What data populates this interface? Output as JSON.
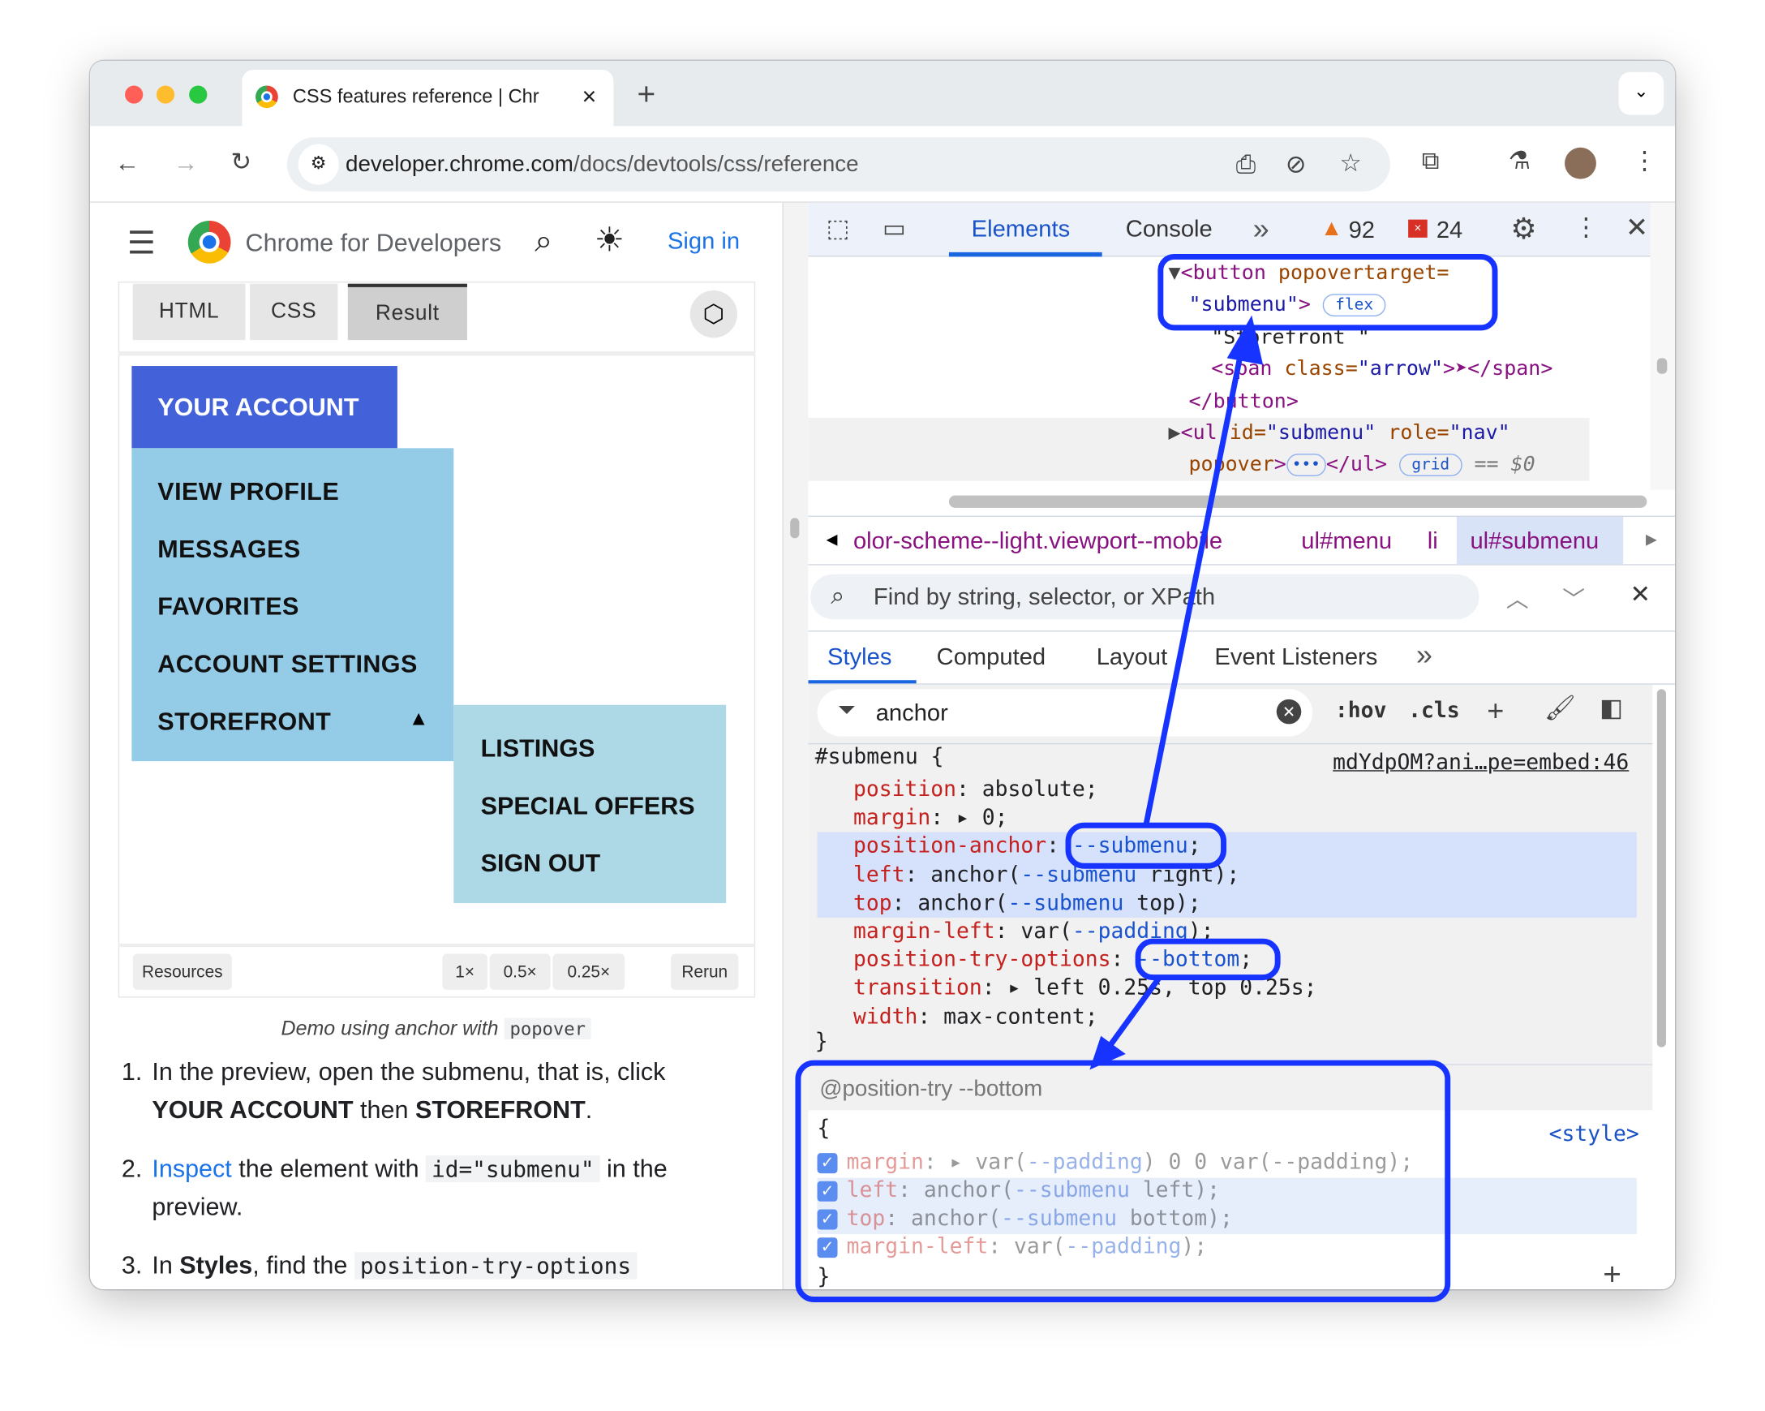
{
  "browser": {
    "tab_title": "CSS features reference | Chr",
    "url_domain": "developer.chrome.com",
    "url_path": "/docs/devtools/css/reference",
    "new_tab": "+",
    "close_tab": "×"
  },
  "site": {
    "name": "Chrome for Developers",
    "sign_in": "Sign in"
  },
  "codepen": {
    "tabs": [
      "HTML",
      "CSS",
      "Result"
    ],
    "active_tab": "Result",
    "menu_button": "YOUR ACCOUNT",
    "menu_items": [
      "VIEW PROFILE",
      "MESSAGES",
      "FAVORITES",
      "ACCOUNT SETTINGS",
      "STOREFRONT"
    ],
    "arrow": "▲",
    "submenu_items": [
      "LISTINGS",
      "SPECIAL OFFERS",
      "SIGN OUT"
    ],
    "footer": {
      "resources": "Resources",
      "zoom": [
        "1×",
        "0.5×",
        "0.25×"
      ],
      "rerun": "Rerun"
    }
  },
  "article": {
    "caption_text": "Demo using anchor with",
    "caption_code": "popover",
    "steps": [
      {
        "num": "1.",
        "a": "In the preview, open the submenu, that is, click ",
        "b1": "YOUR ACCOUNT",
        "c": " then ",
        "b2": "STOREFRONT",
        "d": "."
      },
      {
        "num": "2.",
        "link": "Inspect",
        "a": " the element with ",
        "code": "id=\"submenu\"",
        "b": " in the preview."
      },
      {
        "num": "3.",
        "a": "In ",
        "b": "Styles",
        "c": ", find the ",
        "code": "position-try-options"
      }
    ]
  },
  "devtools": {
    "tabs": [
      "Elements",
      "Console"
    ],
    "active_tab": "Elements",
    "more": "»",
    "warnings": "92",
    "errors": "24",
    "dom": {
      "l1_tag": "<button",
      "l1_attr": " popovertarget=",
      "l2_val": "\"submenu\"",
      "l2_close": ">",
      "flex": "flex",
      "l3": "\"Storefront \"",
      "l4_open": "<span",
      "l4_attr": " class=",
      "l4_val": "\"arrow\"",
      "l4_rest": ">➤</span>",
      "l5": "</button>",
      "l6_tag": "<ul",
      "l6_a1": " id=",
      "l6_v1": "\"submenu\"",
      "l6_a2": " role=",
      "l6_v2": "\"nav\"",
      "l7_attr": "popover",
      "l7_close": ">",
      "l7_end": "</ul>",
      "grid": "grid",
      "dollar": "== $0"
    },
    "breadcrumbs": [
      "olor-scheme--light.viewport--mobile",
      "ul#menu",
      "li",
      "ul#submenu"
    ],
    "search_placeholder": "Find by string, selector, or XPath",
    "subtabs": [
      "Styles",
      "Computed",
      "Layout",
      "Event Listeners"
    ],
    "filter_value": "anchor",
    "hov": ":hov",
    "cls": ".cls",
    "rule1": {
      "selector": "#submenu {",
      "source": "mdYdpOM?ani…pe=embed:46",
      "decls": [
        {
          "p": "position",
          "v": "absolute;"
        },
        {
          "p": "margin",
          "v": "▸ 0;"
        },
        {
          "p": "position-anchor",
          "v": "",
          "var": "--submenu",
          "end": ";"
        },
        {
          "p": "left",
          "v": "anchor(",
          "var": "--submenu",
          "end": " right);"
        },
        {
          "p": "top",
          "v": "anchor(",
          "var": "--submenu",
          "end": " top);"
        },
        {
          "p": "margin-left",
          "v": "var(",
          "var": "--padding",
          "end": ");"
        },
        {
          "p": "position-try-options",
          "v": "",
          "var": "--bottom",
          "end": ";"
        },
        {
          "p": "transition",
          "v": "▸ left 0.25s, top 0.25s;"
        },
        {
          "p": "width",
          "v": "max-content;"
        }
      ],
      "close": "}"
    },
    "rule2": {
      "header": "@position-try --bottom",
      "open": "{",
      "source": "<style>",
      "decls": [
        {
          "p": "margin",
          "v": "▸ var(",
          "var": "--padding",
          "end": ") 0 0 var(--padding);"
        },
        {
          "p": "left",
          "v": "anchor(",
          "var": "--submenu",
          "end": " left);"
        },
        {
          "p": "top",
          "v": "anchor(",
          "var": "--submenu",
          "end": " bottom);"
        },
        {
          "p": "margin-left",
          "v": "var(",
          "var": "--padding",
          "end": ");"
        }
      ],
      "close": "}"
    }
  },
  "colors": {
    "annotation": "#1733ff",
    "menu_button": "#4361d9",
    "menu": "#94cbe7",
    "submenu": "#add8e6",
    "link": "#1a73e8"
  }
}
